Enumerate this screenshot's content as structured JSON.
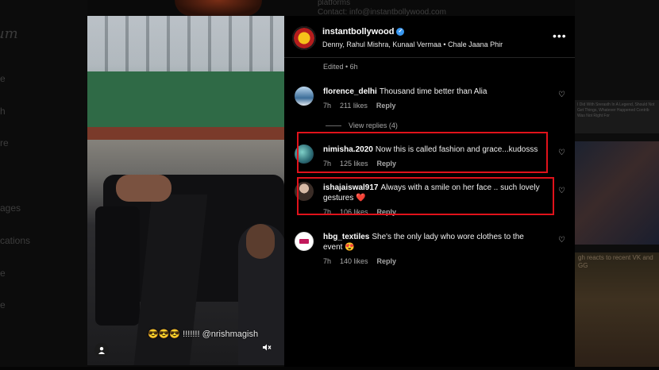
{
  "background": {
    "logo_partial": "um",
    "nav_items": [
      "e",
      "h",
      "re",
      "ages",
      "cations",
      "e",
      "e"
    ],
    "contact": "Contact: info@instantbollywood.com",
    "platforms": "platforms",
    "side_card_text": "I Did With Srerasth In A Legend, Should Not Get Things, Whatever Happened Contrib Was Not Right For",
    "side_card_caption": "gh reacts to recent VK and GG"
  },
  "video": {
    "caption": "😎😎😎 !!!!!!! @nrishmagish",
    "user_icon": "user-icon",
    "mute_icon": "mute-icon"
  },
  "post": {
    "account": "instantbollywood",
    "subtitle": "Denny, Rahul Mishra, Kunaal Vermaa • Chale Jaana Phir",
    "more": "•••",
    "edited": "Edited • 6h"
  },
  "comments": [
    {
      "user": "florence_delhi",
      "text": "Thousand time better than Alia",
      "time": "7h",
      "likes": "211 likes",
      "reply": "Reply",
      "view_replies": "View replies (4)"
    },
    {
      "user": "nimisha.2020",
      "text": "Now this is called fashion and grace...kudosss",
      "time": "7h",
      "likes": "125 likes",
      "reply": "Reply"
    },
    {
      "user": "ishajaiswal917",
      "text": "Always with a smile on her face .. such lovely gestures ❤️",
      "time": "7h",
      "likes": "106 likes",
      "reply": "Reply"
    },
    {
      "user": "hbg_textiles",
      "text": "She's the only lady who wore clothes to the event 😍",
      "time": "7h",
      "likes": "140 likes",
      "reply": "Reply"
    }
  ],
  "colors": {
    "highlight_box": "#e0121b",
    "verified": "#3897f0"
  }
}
